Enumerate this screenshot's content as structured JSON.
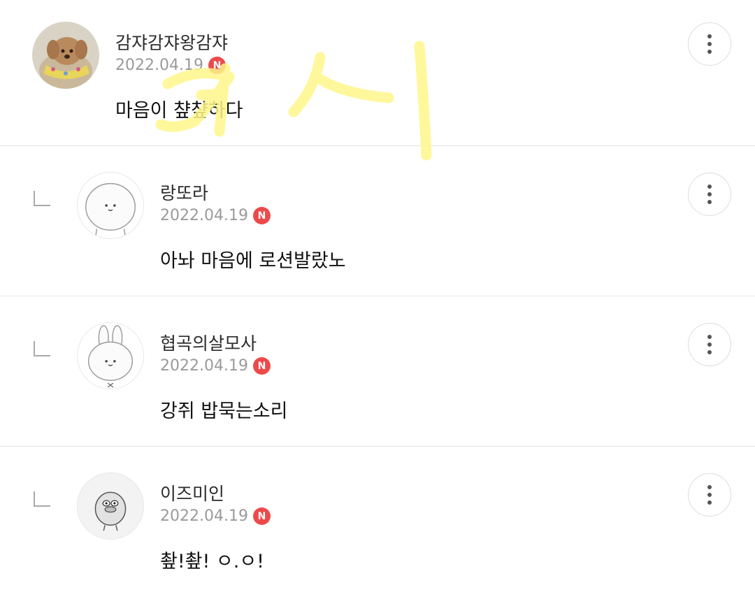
{
  "comments": [
    {
      "author": "감쟈감쟈왕감쟈",
      "date": "2022.04.19",
      "badge": "N",
      "text": "마음이 챺챺하다",
      "is_reply": false,
      "avatar_icon": "poodle-photo-icon"
    },
    {
      "author": "랑또라",
      "date": "2022.04.19",
      "badge": "N",
      "text": "아놔 마음에 로션발랐노",
      "is_reply": true,
      "avatar_icon": "round-character-icon"
    },
    {
      "author": "협곡의살모사",
      "date": "2022.04.19",
      "badge": "N",
      "text": "강쥐 밥묵는소리",
      "is_reply": true,
      "avatar_icon": "rabbit-character-icon"
    },
    {
      "author": "이즈미인",
      "date": "2022.04.19",
      "badge": "N",
      "text": "촾!촾! ㅇ.ㅇ!",
      "is_reply": true,
      "avatar_icon": "duck-character-icon"
    }
  ],
  "more_icon": "more-vertical-icon",
  "reply_icon": "reply-indent-icon",
  "annotation_color": "#fff68a"
}
